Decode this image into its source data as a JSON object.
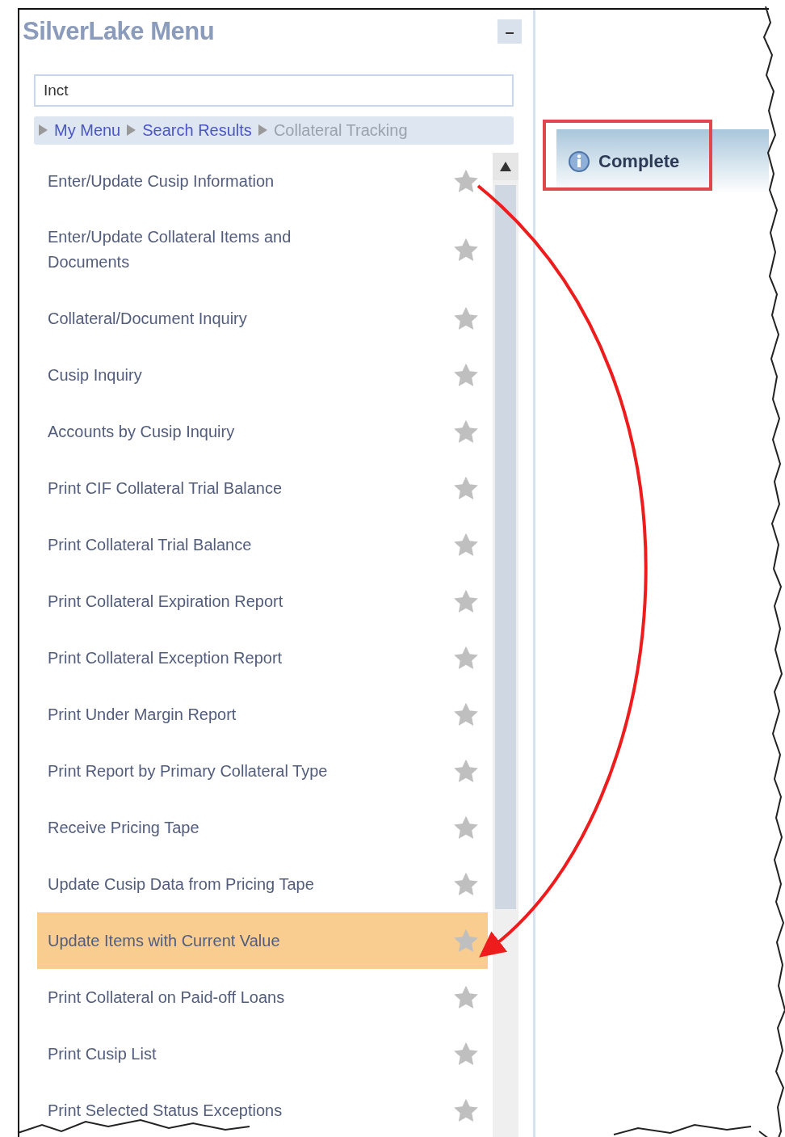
{
  "menu": {
    "title": "SilverLake Menu",
    "minimize_label": "–",
    "search": {
      "value": "Inct"
    },
    "breadcrumb": [
      {
        "label": "My Menu",
        "kind": "link"
      },
      {
        "label": "Search Results",
        "kind": "link"
      },
      {
        "label": "Collateral Tracking",
        "kind": "current"
      }
    ],
    "items": [
      {
        "label": "Enter/Update Cusip Information",
        "selected": false
      },
      {
        "label": "Enter/Update Collateral Items and Documents",
        "selected": false
      },
      {
        "label": "Collateral/Document Inquiry",
        "selected": false
      },
      {
        "label": "Cusip Inquiry",
        "selected": false
      },
      {
        "label": "Accounts by Cusip Inquiry",
        "selected": false
      },
      {
        "label": "Print CIF Collateral Trial Balance",
        "selected": false
      },
      {
        "label": "Print Collateral Trial Balance",
        "selected": false
      },
      {
        "label": "Print Collateral Expiration Report",
        "selected": false
      },
      {
        "label": "Print Collateral Exception Report",
        "selected": false
      },
      {
        "label": "Print Under Margin Report",
        "selected": false
      },
      {
        "label": "Print Report by Primary Collateral Type",
        "selected": false
      },
      {
        "label": "Receive Pricing Tape",
        "selected": false
      },
      {
        "label": "Update Cusip Data from Pricing Tape",
        "selected": false
      },
      {
        "label": "Update Items with Current Value",
        "selected": true
      },
      {
        "label": "Print Collateral on Paid-off Loans",
        "selected": false
      },
      {
        "label": "Print Cusip List",
        "selected": false
      },
      {
        "label": "Print Selected Status Exceptions",
        "selected": false
      }
    ]
  },
  "status": {
    "label": "Complete"
  }
}
